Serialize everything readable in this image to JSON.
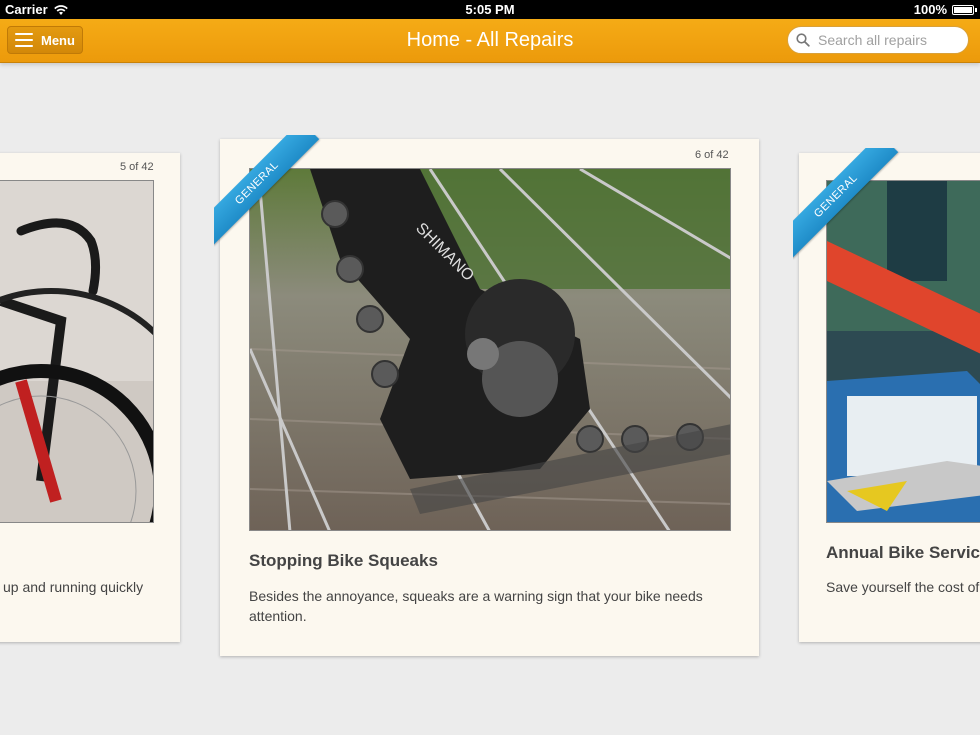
{
  "status_bar": {
    "carrier": "Carrier",
    "time": "5:05 PM",
    "battery": "100%",
    "battery_level": 1.0
  },
  "nav": {
    "menu_label": "Menu",
    "title": "Home - All Repairs",
    "search_placeholder": "Search all repairs"
  },
  "cards": [
    {
      "counter": "5 of 42",
      "title": "",
      "description": "up and running quickly"
    },
    {
      "counter": "6 of 42",
      "category": "GENERAL",
      "title": "Stopping Bike Squeaks",
      "description": "Besides the annoyance, squeaks are a warning sign that your bike needs attention."
    },
    {
      "category": "GENERAL",
      "title": "Annual Bike Service",
      "description": "Save yourself the cost of"
    }
  ],
  "colors": {
    "nav_orange": "#f0a20f",
    "ribbon_blue": "#2a9ad6",
    "card_bg": "#fcf8ef",
    "page_bg": "#ececec"
  }
}
